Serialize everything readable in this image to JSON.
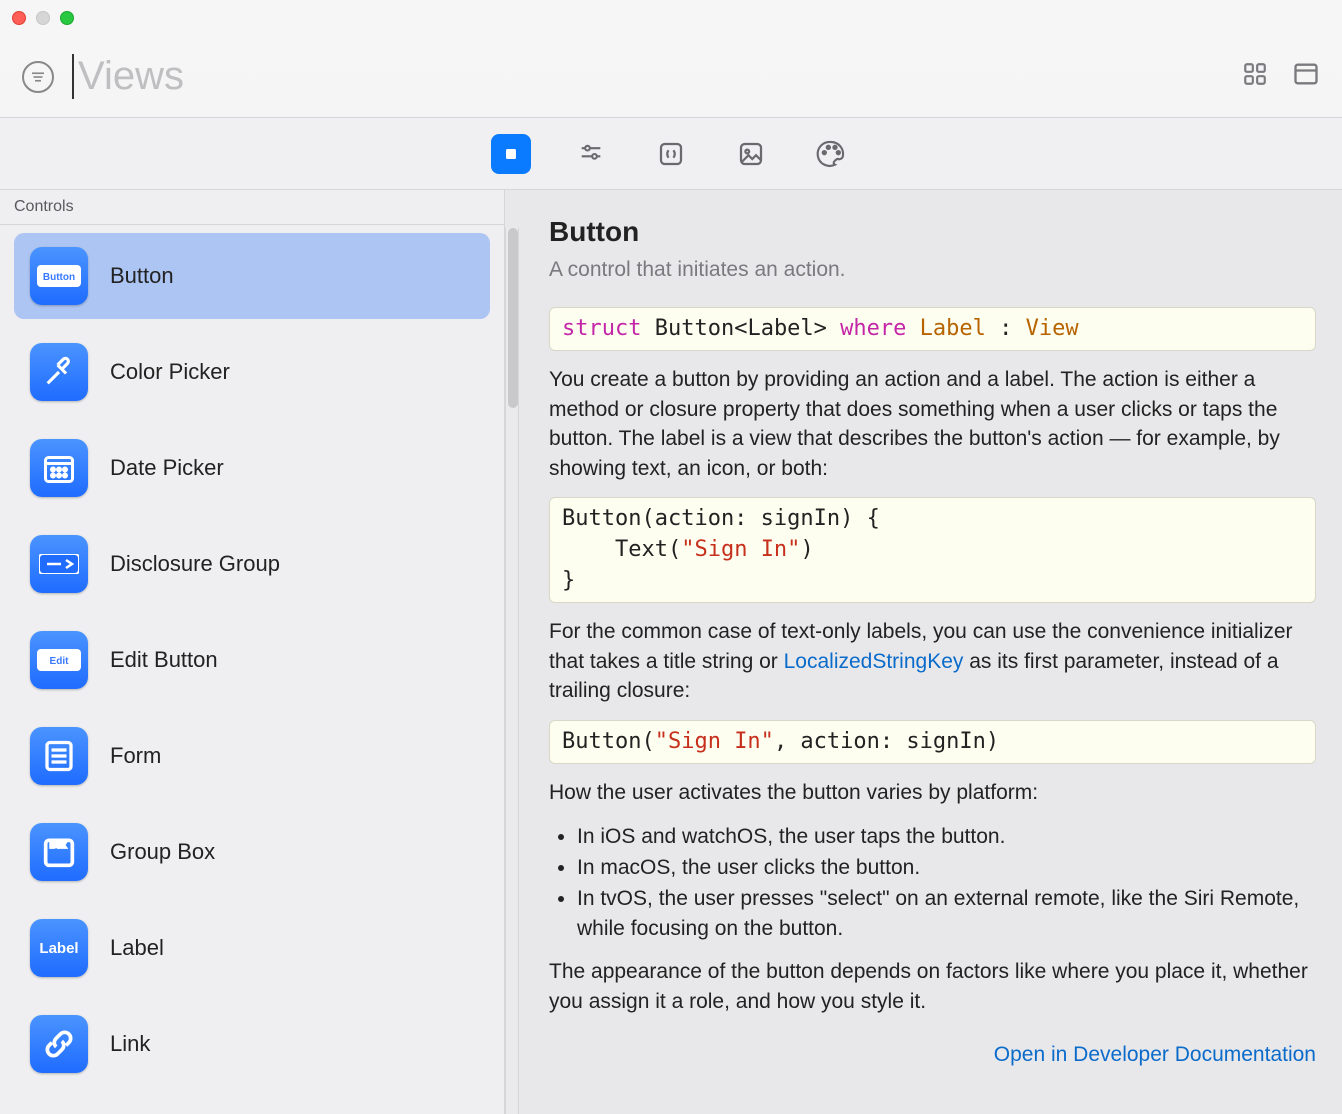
{
  "search": {
    "placeholder": "Views"
  },
  "sidebar": {
    "category": "Controls",
    "items": [
      {
        "label": "Button",
        "icon": "button",
        "selected": true
      },
      {
        "label": "Color Picker",
        "icon": "eyedropper",
        "selected": false
      },
      {
        "label": "Date Picker",
        "icon": "calendar",
        "selected": false
      },
      {
        "label": "Disclosure Group",
        "icon": "disclosure",
        "selected": false
      },
      {
        "label": "Edit Button",
        "icon": "edit",
        "selected": false
      },
      {
        "label": "Form",
        "icon": "form",
        "selected": false
      },
      {
        "label": "Group Box",
        "icon": "box",
        "selected": false
      },
      {
        "label": "Label",
        "icon": "label",
        "selected": false
      },
      {
        "label": "Link",
        "icon": "link",
        "selected": false
      }
    ]
  },
  "detail": {
    "title": "Button",
    "subtitle": "A control that initiates an action.",
    "declaration": {
      "keyword_struct": "struct",
      "name": "Button<Label>",
      "keyword_where": "where",
      "label_type": "Label",
      "colon": " : ",
      "view_type": "View"
    },
    "p1": "You create a button by providing an action and a label. The action is either a method or closure property that does something when a user clicks or taps the button. The label is a view that describes the button's action — for example, by showing text, an icon, or both:",
    "code1_l1": "Button(action: signIn) {",
    "code1_l2_pre": "    Text(",
    "code1_l2_str": "\"Sign In\"",
    "code1_l2_post": ")",
    "code1_l3": "}",
    "p2_pre": "For the common case of text-only labels, you can use the convenience initializer that takes a title string or ",
    "p2_link": "LocalizedStringKey",
    "p2_post": " as its first parameter, instead of a trailing closure:",
    "code2_pre": "Button(",
    "code2_str": "\"Sign In\"",
    "code2_post": ", action: signIn)",
    "p3": "How the user activates the button varies by platform:",
    "bullets": [
      "In iOS and watchOS, the user taps the button.",
      "In macOS, the user clicks the button.",
      "In tvOS, the user presses \"select\" on an external remote, like the Siri Remote, while focusing on the button."
    ],
    "p4": "The appearance of the button depends on factors like where you place it, whether you assign it a role, and how you style it.",
    "open_link": "Open in Developer Documentation"
  }
}
